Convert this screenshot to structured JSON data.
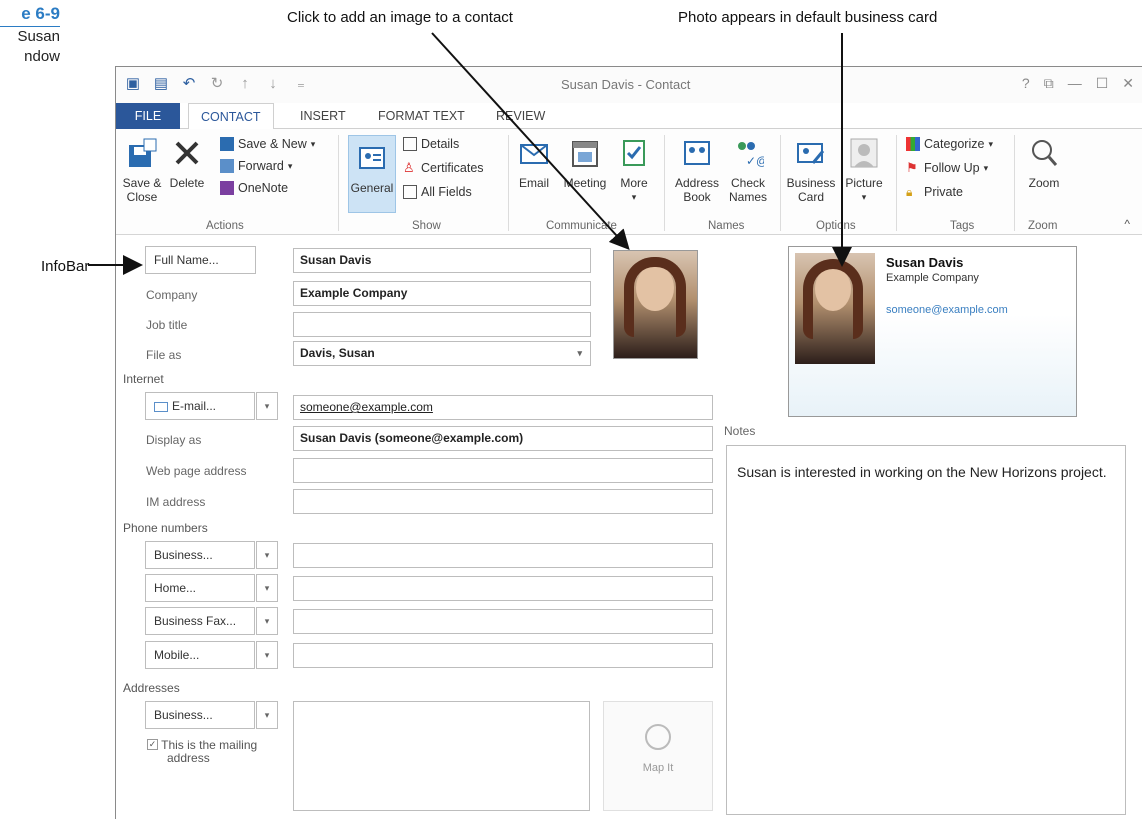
{
  "figure": {
    "number": "e 6-9",
    "line1": "Susan",
    "line2": "ndow"
  },
  "callouts": {
    "add_image": "Click to add an image to a contact",
    "business_card_photo": "Photo appears in default business card",
    "infobar": "InfoBar"
  },
  "window": {
    "title": "Susan Davis - Contact",
    "help": "?",
    "restore": "⧉",
    "minimize": "—",
    "maximize": "☐",
    "close": "✕"
  },
  "tabs": [
    "FILE",
    "CONTACT",
    "INSERT",
    "FORMAT TEXT",
    "REVIEW"
  ],
  "ribbon": {
    "actions": {
      "save_close": "Save &\nClose",
      "delete": "Delete",
      "save_new": "Save & New",
      "forward": "Forward",
      "onenote": "OneNote",
      "label": "Actions"
    },
    "show": {
      "general": "General",
      "details": "Details",
      "certificates": "Certificates",
      "all_fields": "All Fields",
      "label": "Show"
    },
    "communicate": {
      "email": "Email",
      "meeting": "Meeting",
      "more": "More",
      "label": "Communicate"
    },
    "names": {
      "address_book": "Address\nBook",
      "check_names": "Check\nNames",
      "label": "Names"
    },
    "options": {
      "business_card": "Business\nCard",
      "picture": "Picture",
      "label": "Options"
    },
    "tags": {
      "categorize": "Categorize",
      "follow_up": "Follow Up",
      "private": "Private",
      "label": "Tags"
    },
    "zoom": {
      "zoom": "Zoom",
      "label": "Zoom"
    }
  },
  "form": {
    "full_name_btn": "Full Name...",
    "full_name": "Susan Davis",
    "company_label": "Company",
    "company": "Example Company",
    "job_title_label": "Job title",
    "job_title": "",
    "file_as_label": "File as",
    "file_as": "Davis, Susan",
    "internet_label": "Internet",
    "email_btn": "E-mail...",
    "email": "someone@example.com",
    "display_as_label": "Display as",
    "display_as": "Susan Davis (someone@example.com)",
    "web_label": "Web page address",
    "web": "",
    "im_label": "IM address",
    "im": "",
    "phone_label": "Phone numbers",
    "phone_btns": [
      "Business...",
      "Home...",
      "Business Fax...",
      "Mobile..."
    ],
    "addresses_label": "Addresses",
    "address_btn": "Business...",
    "mailing_checkbox": "This is the mailing",
    "mailing_checkbox2": "address",
    "map_it": "Map It"
  },
  "card": {
    "name": "Susan Davis",
    "company": "Example Company",
    "email": "someone@example.com"
  },
  "notes": {
    "label": "Notes",
    "text": "Susan is interested in working on the New Horizons project."
  }
}
